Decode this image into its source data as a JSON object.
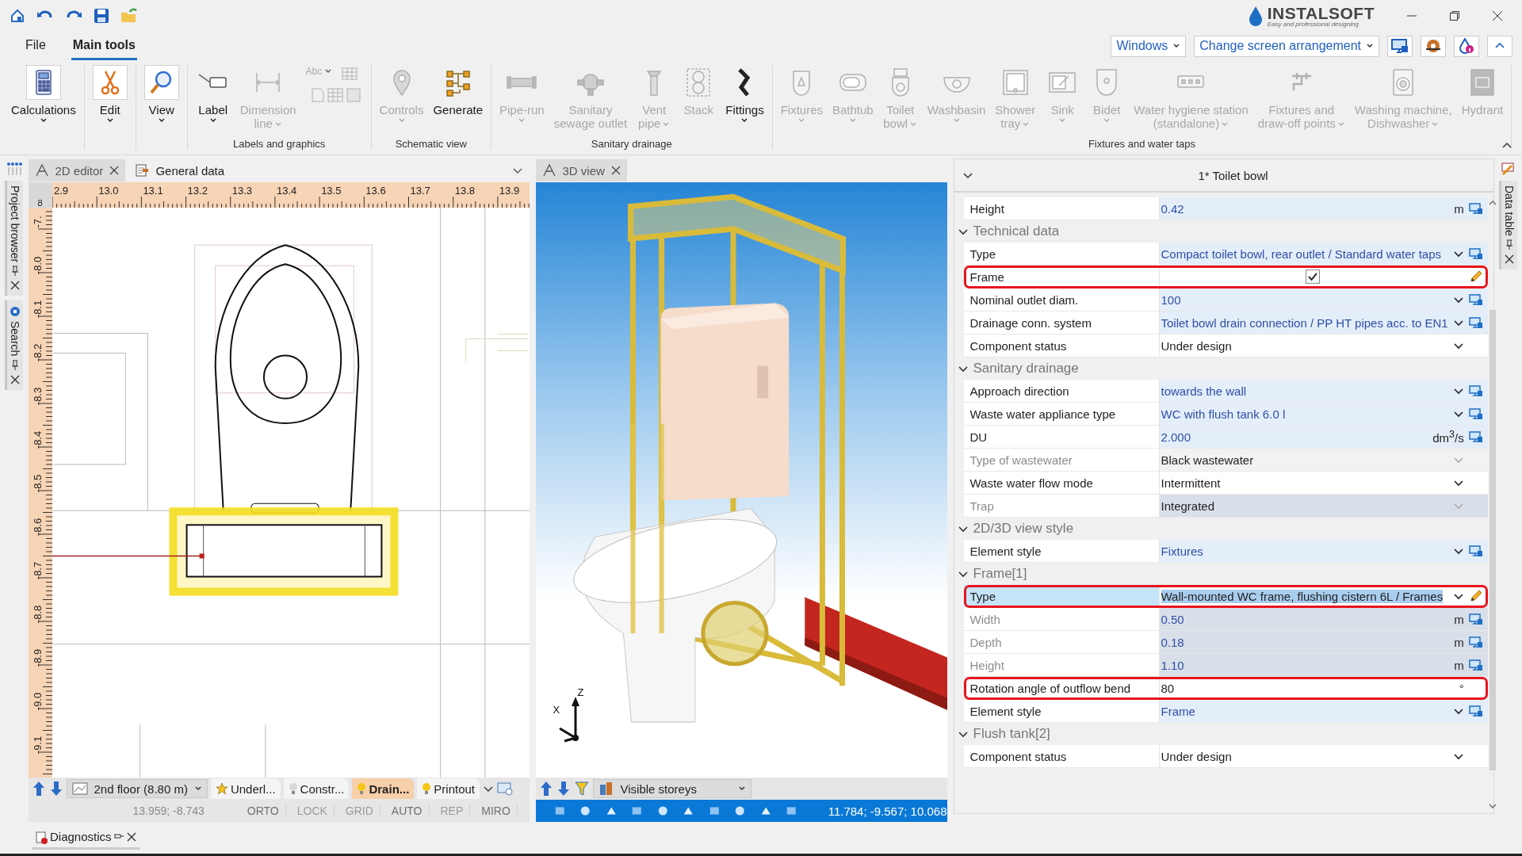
{
  "title_bar": {
    "logo": {
      "name": "INSTALSOFT",
      "tagline": "Easy and professional designing"
    }
  },
  "menu_tabs": [
    {
      "label": "File",
      "selected": false
    },
    {
      "label": "Main tools",
      "selected": true
    }
  ],
  "toolbar_right": {
    "windows": "Windows",
    "arrangement": "Change screen arrangement"
  },
  "ribbon": [
    {
      "items": [
        {
          "label": "Calculations",
          "dropdown": true,
          "disabled": false
        }
      ]
    },
    {
      "items": [
        {
          "label": "Edit",
          "dropdown": true,
          "disabled": false
        }
      ]
    },
    {
      "items": [
        {
          "label": "View",
          "dropdown": true,
          "disabled": false
        }
      ]
    },
    {
      "label": "Labels and graphics",
      "mini_text": "Abc",
      "items": [
        {
          "label": "Label",
          "dropdown": true,
          "disabled": false
        },
        {
          "label": "Dimension\nline",
          "dropdown": true,
          "disabled": true
        }
      ]
    },
    {
      "label": "Schematic view",
      "items": [
        {
          "label": "Controls",
          "dropdown": true,
          "disabled": true
        },
        {
          "label": "Generate",
          "dropdown": false,
          "disabled": false
        }
      ]
    },
    {
      "label": "Sanitary drainage",
      "items": [
        {
          "label": "Pipe-run",
          "dropdown": true,
          "disabled": true
        },
        {
          "label": "Sanitary\nsewage outlet",
          "dropdown": false,
          "disabled": true
        },
        {
          "label": "Vent\npipe",
          "dropdown": true,
          "disabled": true
        },
        {
          "label": "Stack",
          "dropdown": false,
          "disabled": true
        },
        {
          "label": "Fittings",
          "dropdown": true,
          "disabled": false
        }
      ]
    },
    {
      "label": "Fixtures and water taps",
      "items": [
        {
          "label": "Fixtures",
          "dropdown": true,
          "disabled": true
        },
        {
          "label": "Bathtub",
          "dropdown": true,
          "disabled": true
        },
        {
          "label": "Toilet\nbowl",
          "dropdown": true,
          "disabled": true
        },
        {
          "label": "Washbasin",
          "dropdown": true,
          "disabled": true
        },
        {
          "label": "Shower\ntray",
          "dropdown": true,
          "disabled": true
        },
        {
          "label": "Sink",
          "dropdown": true,
          "disabled": true
        },
        {
          "label": "Bidet",
          "dropdown": true,
          "disabled": true
        },
        {
          "label": "Water hygiene station\n(standalone)",
          "dropdown": true,
          "disabled": true
        },
        {
          "label": "Fixtures and\ndraw-off points",
          "dropdown": true,
          "disabled": true
        },
        {
          "label": "Washing machine,\nDishwasher",
          "dropdown": true,
          "disabled": true
        },
        {
          "label": "Hydrant",
          "dropdown": false,
          "disabled": true
        }
      ]
    }
  ],
  "left_dock": [
    {
      "label": "Project browser"
    },
    {
      "label": "Search"
    }
  ],
  "right_dock": {
    "label": "Data table"
  },
  "editor_2d": {
    "tabs": [
      {
        "label": "2D editor",
        "selected": true
      },
      {
        "label": "General data",
        "selected": false
      }
    ],
    "ruler_corner": "8",
    "x_ruler": [
      "2.9",
      "13.0",
      "13.1",
      "13.2",
      "13.3",
      "13.4",
      "13.5",
      "13.6",
      "13.7",
      "13.8",
      "13.9"
    ],
    "y_ruler": [
      "-7.",
      "-8.0",
      "-8.1",
      "-8.2",
      "-8.3",
      "-8.4",
      "-8.5",
      "-8.6",
      "-8.7",
      "-8.8",
      "-8.9",
      "-9.0",
      "-9.1"
    ],
    "floor": "2nd floor (8.80 m)",
    "layers": [
      {
        "label": "Underl...",
        "selected": false,
        "on": true
      },
      {
        "label": "Constr...",
        "selected": false,
        "on": false
      },
      {
        "label": "Drain...",
        "selected": true,
        "on": true
      },
      {
        "label": "Printout",
        "selected": false,
        "on": true
      }
    ],
    "coordinates": "13.959; -8.743",
    "toggles": [
      {
        "label": "ORTO",
        "on": true
      },
      {
        "label": "LOCK",
        "on": false
      },
      {
        "label": "GRID",
        "on": false
      },
      {
        "label": "AUTO",
        "on": true
      },
      {
        "label": "REP",
        "on": false
      },
      {
        "label": "MIRO",
        "on": true
      }
    ]
  },
  "view_3d": {
    "tab": "3D view",
    "axes": [
      "Z",
      "X"
    ],
    "storeys": "Visible storeys",
    "coordinates": "11.784; -9.567; 10.068"
  },
  "properties": {
    "title": "1* Toilet bowl",
    "top_rows": [
      {
        "label": "Height",
        "value": "0.42",
        "unit": "m",
        "kind": "text",
        "linked": true,
        "disabled": false,
        "readonly": false,
        "highlighted": false,
        "selected": false,
        "edited": false
      }
    ],
    "sections": [
      {
        "title": "Technical data",
        "expanded": true,
        "rows": [
          {
            "label": "Type",
            "value": "Compact toilet bowl, rear outlet / Standard water taps",
            "kind": "dropdown",
            "linked": true,
            "disabled": false,
            "readonly": false,
            "highlighted": false,
            "selected": false,
            "edited": false
          },
          {
            "label": "Frame",
            "kind": "checkbox",
            "checked": true,
            "linked": false,
            "disabled": false,
            "readonly": false,
            "highlighted": true,
            "selected": false,
            "edited": true
          },
          {
            "label": "Nominal outlet diam.",
            "value": "100",
            "kind": "dropdown",
            "linked": true,
            "disabled": false,
            "readonly": false,
            "highlighted": false,
            "selected": false,
            "edited": false
          },
          {
            "label": "Drainage conn. system",
            "value": "Toilet bowl drain connection / PP HT pipes acc. to EN1",
            "kind": "dropdown",
            "linked": true,
            "disabled": false,
            "readonly": false,
            "highlighted": false,
            "selected": false,
            "edited": false
          },
          {
            "label": "Component status",
            "value": "Under design",
            "kind": "dropdown",
            "linked": false,
            "disabled": false,
            "readonly": false,
            "highlighted": false,
            "selected": false,
            "edited": false
          }
        ]
      },
      {
        "title": "Sanitary drainage",
        "expanded": true,
        "rows": [
          {
            "label": "Approach direction",
            "value": "towards the wall",
            "kind": "dropdown",
            "linked": true,
            "disabled": false,
            "readonly": false,
            "highlighted": false,
            "selected": false,
            "edited": false
          },
          {
            "label": "Waste water appliance type",
            "value": "WC with flush tank 6.0 l",
            "kind": "dropdown",
            "linked": true,
            "disabled": false,
            "readonly": false,
            "highlighted": false,
            "selected": false,
            "edited": false
          },
          {
            "label": "DU",
            "value": "2.000",
            "unit": "dm$^{3}$/s",
            "kind": "text",
            "linked": true,
            "disabled": false,
            "readonly": false,
            "highlighted": false,
            "selected": false,
            "edited": false
          },
          {
            "label": "Type of wastewater",
            "value": "Black wastewater",
            "kind": "dropdown",
            "linked": false,
            "disabled": true,
            "readonly": false,
            "highlighted": false,
            "selected": false,
            "edited": false
          },
          {
            "label": "Waste water flow mode",
            "value": "Intermittent",
            "kind": "dropdown",
            "linked": false,
            "disabled": false,
            "readonly": false,
            "highlighted": false,
            "selected": false,
            "edited": false
          },
          {
            "label": "Trap",
            "value": "Integrated",
            "kind": "dropdown",
            "linked": false,
            "disabled": true,
            "readonly": true,
            "highlighted": false,
            "selected": false,
            "edited": false
          }
        ]
      },
      {
        "title": "2D/3D view style",
        "expanded": true,
        "rows": [
          {
            "label": "Element style",
            "value": "Fixtures",
            "kind": "dropdown",
            "linked": true,
            "disabled": false,
            "readonly": false,
            "highlighted": false,
            "selected": false,
            "edited": false
          }
        ]
      },
      {
        "title": "Frame[1]",
        "expanded": true,
        "rows": [
          {
            "label": "Type",
            "value": "Wall-mounted WC frame, flushing cistern 6L / Frames",
            "kind": "dropdown",
            "linked": false,
            "disabled": false,
            "readonly": false,
            "highlighted": true,
            "selected": true,
            "edited": true
          },
          {
            "label": "Width",
            "value": "0.50",
            "unit": "m",
            "kind": "text",
            "linked": true,
            "disabled": true,
            "readonly": true,
            "highlighted": false,
            "selected": false,
            "edited": false
          },
          {
            "label": "Depth",
            "value": "0.18",
            "unit": "m",
            "kind": "text",
            "linked": true,
            "disabled": true,
            "readonly": true,
            "highlighted": false,
            "selected": false,
            "edited": false
          },
          {
            "label": "Height",
            "value": "1.10",
            "unit": "m",
            "kind": "text",
            "linked": true,
            "disabled": true,
            "readonly": true,
            "highlighted": false,
            "selected": false,
            "edited": false
          },
          {
            "label": "Rotation angle of outflow bend",
            "value": "80",
            "unit": "°",
            "kind": "text",
            "linked": false,
            "disabled": false,
            "readonly": false,
            "highlighted": true,
            "selected": false,
            "edited": false
          },
          {
            "label": "Element style",
            "value": "Frame",
            "kind": "dropdown",
            "linked": true,
            "disabled": false,
            "readonly": false,
            "highlighted": false,
            "selected": false,
            "edited": false
          }
        ]
      },
      {
        "title": "Flush tank[2]",
        "expanded": true,
        "rows": [
          {
            "label": "Component status",
            "value": "Under design",
            "kind": "dropdown",
            "linked": false,
            "disabled": false,
            "readonly": false,
            "highlighted": false,
            "selected": false,
            "edited": false
          }
        ]
      }
    ]
  },
  "bottom_dock": {
    "label": "Diagnostics"
  }
}
